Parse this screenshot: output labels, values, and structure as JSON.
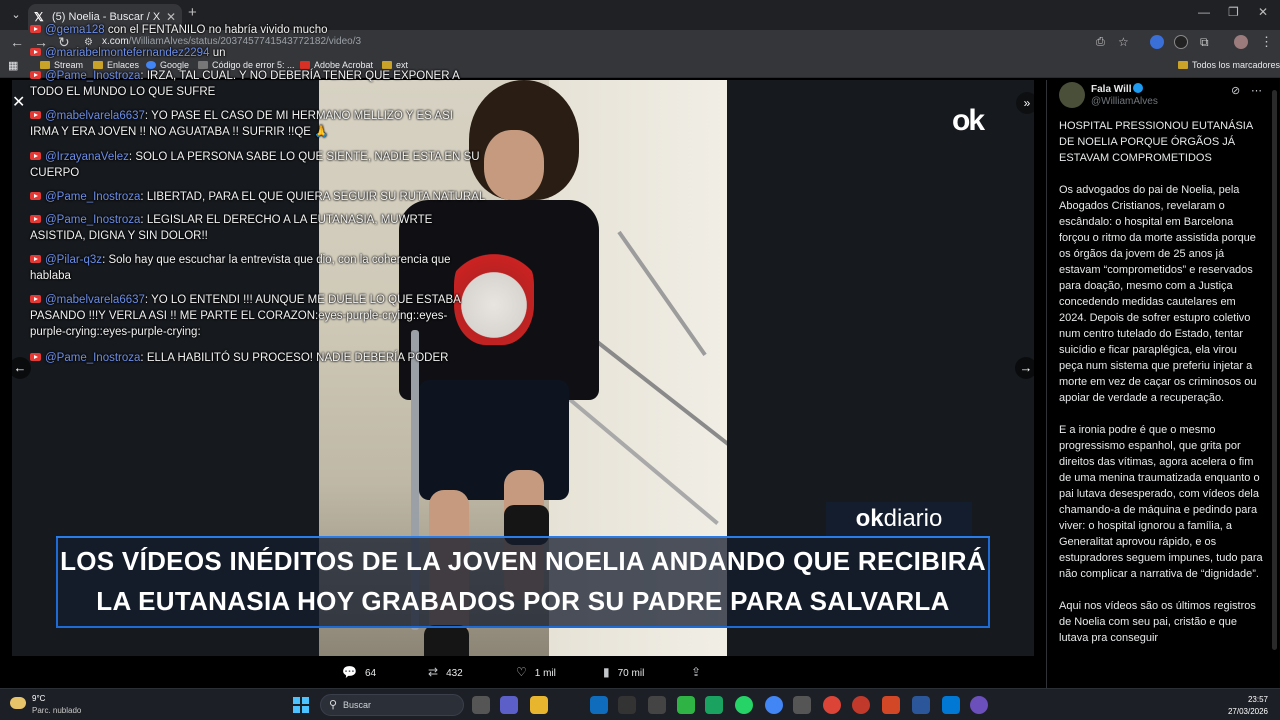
{
  "browser": {
    "tab_title": "(5) Noelia - Buscar / X",
    "url_domain": "x.com",
    "url_path": "/WilliamAlves/status/2037457741543772182/video/3",
    "bookmarks": [
      "Stream",
      "Enlaces",
      "Google",
      "Código de error 5: ...",
      "Adobe Acrobat",
      "ext"
    ],
    "all_bookmarks": "Todos los marcadores"
  },
  "chat": [
    {
      "user": "@gema128",
      "text": "con el FENTANILO no habría vivido mucho"
    },
    {
      "user": "@mariabelmontefernandez2294",
      "text": "un"
    },
    {
      "user": "@Pame_Inostroza",
      "text": "IRZA, TAL CUAL. Y NO DEBERÍA TENER QUE EXPONER A",
      "text2": "TODO EL MUNDO LO QUE SUFRE"
    },
    {
      "user": "@mabelvarela6637",
      "text": "YO PASE EL CASO DE MI HERMANO MELLIZO Y ES ASI",
      "text2": "IRMA Y ERA JOVEN !! NO AGUATABA !! SUFRIR !!QE 🙏"
    },
    {
      "user": "@IrzayanaVelez",
      "text": "SOLO LA PERSONA SABE LO QUE SIENTE, NADIE ESTA EN SU",
      "text2": "CUERPO"
    },
    {
      "user": "@Pame_Inostroza",
      "text": "LIBERTAD, PARA EL QUE QUIERA SEGUIR SU RUTA NATURAL"
    },
    {
      "user": "@Pame_Inostroza",
      "text": "LEGISLAR EL DERECHO A LA EUTANASIA, MUWRTE",
      "text2": "ASISTIDA, DIGNA Y SIN DOLOR!!"
    },
    {
      "user": "@Pilar-q3z",
      "text": "Solo hay que escuchar la entrevista que dio, con la coherencia que",
      "text2": "hablaba"
    },
    {
      "user": "@mabelvarela6637",
      "text": "YO LO ENTENDI !!! AUNQUE ME DUELE LO QUE ESTABA",
      "text2": "PASANDO !!!Y VERLA ASI !! ME PARTE EL CORAZON:eyes-purple-crying::eyes-",
      "text3": "purple-crying::eyes-purple-crying:"
    },
    {
      "user": "@Pame_Inostroza",
      "text": "ELLA HABILITÓ SU PROCESO! NADIE DEBERÍA PODER"
    }
  ],
  "video": {
    "watermark": "ok",
    "brand_ok": "ok",
    "brand_diario": "diario",
    "headline_1": "LOS VÍDEOS INÉDITOS DE LA JOVEN NOELIA ANDANDO QUE RECIBIRÁ",
    "headline_2": "LA EUTANASIA HOY GRABADOS POR SU PADRE PARA SALVARLA"
  },
  "actions": {
    "replies": "64",
    "reposts": "432",
    "likes": "1 mil",
    "views": "70 mil"
  },
  "post": {
    "author": "Fala Will",
    "handle": "@WilliamAlves",
    "paragraphs": [
      "HOSPITAL PRESSIONOU EUTANÁSIA DE NOELIA PORQUE ÓRGÃOS JÁ ESTAVAM COMPROMETIDOS",
      "Os advogados do pai de Noelia, pela Abogados Cristianos, revelaram o escândalo: o hospital em Barcelona forçou o ritmo da morte assistida porque os órgãos da jovem de 25 anos já estavam “comprometidos” e reservados para doação, mesmo com a Justiça concedendo medidas cautelares em 2024. Depois de sofrer estupro coletivo num centro tutelado do Estado, tentar suicídio e ficar paraplégica, ela virou peça num sistema que preferiu injetar a morte em vez de caçar os criminosos ou apoiar de verdade a recuperação.",
      "E a ironia podre é que o mesmo progressismo espanhol, que grita por direitos das vítimas, agora acelera o fim de uma menina traumatizada enquanto o pai lutava desesperado, com vídeos dela chamando-a de máquina e pedindo para viver: o hospital ignorou a família, a Generalitat aprovou rápido, e os estupradores seguem impunes, tudo para não complicar a narrativa de “dignidade”.",
      "Aqui nos vídeos são os últimos registros de Noelia com seu pai, cristão e que lutava pra conseguir"
    ]
  },
  "taskbar": {
    "temp": "9°C",
    "weather": "Parc. nublado",
    "search": "Buscar",
    "time": "23:57",
    "date": "27/03/2026"
  },
  "colors": {
    "accent": "#1d9bf0",
    "chat_user": "#6d8ee8",
    "banner_border": "#1e6bd6"
  }
}
